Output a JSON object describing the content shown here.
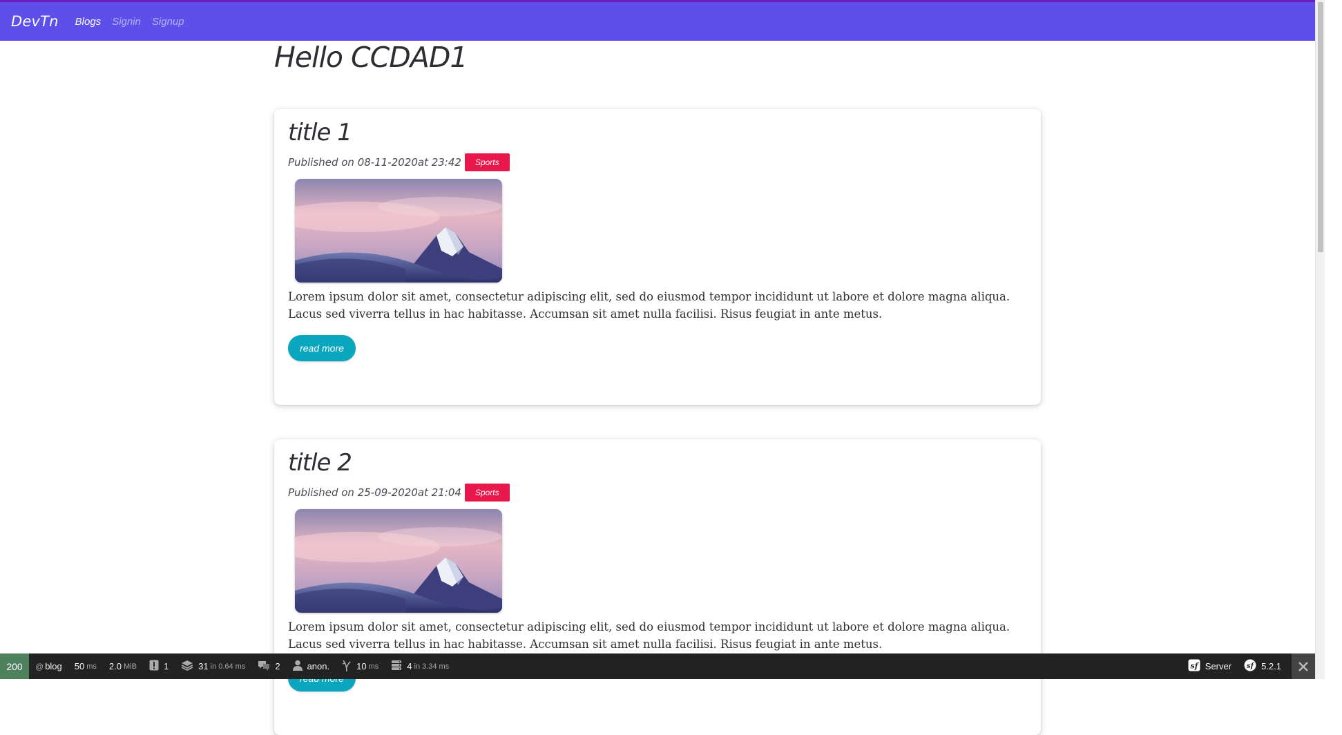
{
  "navbar": {
    "brand": "DevTn",
    "links": [
      {
        "label": "Blogs",
        "active": true
      },
      {
        "label": "Signin",
        "active": false
      },
      {
        "label": "Signup",
        "active": false
      }
    ]
  },
  "page": {
    "title": "Hello CCDAD1"
  },
  "posts": [
    {
      "title": "title 1",
      "published": "Published on 08-11-2020at 23:42",
      "category": "Sports",
      "excerpt": "Lorem ipsum dolor sit amet, consectetur adipiscing elit, sed do eiusmod tempor incididunt ut labore et dolore magna aliqua. Lacus sed viverra tellus in hac habitasse. Accumsan sit amet nulla facilisi. Risus feugiat in ante metus.",
      "read_more": "read more"
    },
    {
      "title": "title 2",
      "published": "Published on 25-09-2020at 21:04",
      "category": "Sports",
      "excerpt": "Lorem ipsum dolor sit amet, consectetur adipiscing elit, sed do eiusmod tempor incididunt ut labore et dolore magna aliqua. Lacus sed viverra tellus in hac habitasse. Accumsan sit amet nulla facilisi. Risus feugiat in ante metus.",
      "read_more": "read more"
    }
  ],
  "debug_toolbar": {
    "status": "200",
    "route_at": "@",
    "route": "blog",
    "time_value": "50",
    "time_unit": "ms",
    "memory_value": "2.0",
    "memory_unit": "MiB",
    "logs": "1",
    "queries": "31",
    "queries_in": "in",
    "queries_time": "0.64 ms",
    "forms": "2",
    "user": "anon.",
    "twig_value": "10",
    "twig_unit": "ms",
    "cache": "4",
    "cache_in": "in",
    "cache_time": "3.34 ms",
    "server": "Server",
    "version": "5.2.1"
  },
  "colors": {
    "navbar": "#5d4fe9",
    "badge": "#e8184c",
    "read_more": "#0aa6be",
    "status_ok": "#4f805d"
  }
}
